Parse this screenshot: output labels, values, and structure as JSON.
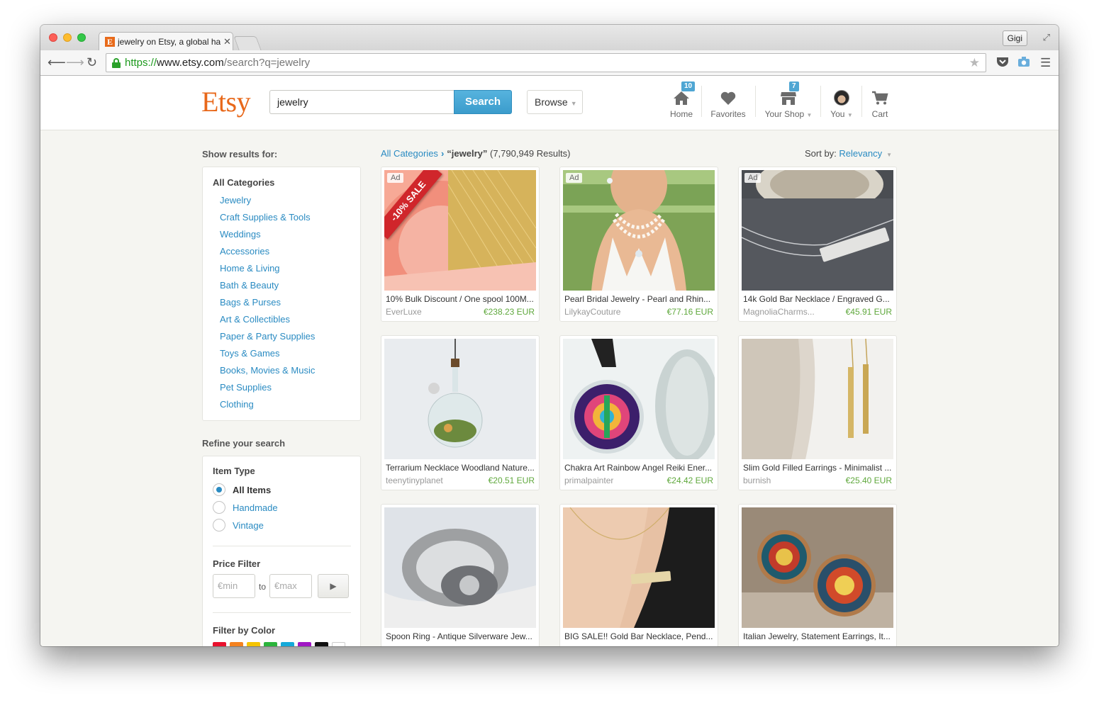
{
  "browser": {
    "tab_title": "jewelry on Etsy, a global handmade",
    "tab_favicon": "E",
    "profile_name": "Gigi",
    "url_scheme": "https://",
    "url_host": "www.etsy.com",
    "url_path": "/search?q=jewelry"
  },
  "header": {
    "logo": "Etsy",
    "search_value": "jewelry",
    "search_button": "Search",
    "browse_label": "Browse",
    "nav": [
      {
        "label": "Home",
        "badge": "10",
        "icon": "home-icon"
      },
      {
        "label": "Favorites",
        "badge": "",
        "icon": "heart-icon"
      },
      {
        "label": "Your Shop",
        "badge": "7",
        "icon": "shop-icon"
      },
      {
        "label": "You",
        "badge": "",
        "icon": "avatar"
      },
      {
        "label": "Cart",
        "badge": "",
        "icon": "cart-icon"
      }
    ]
  },
  "sidebar": {
    "show_results_heading": "Show results for:",
    "all_categories": "All Categories",
    "categories": [
      "Jewelry",
      "Craft Supplies & Tools",
      "Weddings",
      "Accessories",
      "Home & Living",
      "Bath & Beauty",
      "Bags & Purses",
      "Art & Collectibles",
      "Paper & Party Supplies",
      "Toys & Games",
      "Books, Movies & Music",
      "Pet Supplies",
      "Clothing"
    ],
    "refine_heading": "Refine your search",
    "item_type_heading": "Item Type",
    "item_types": [
      {
        "label": "All Items",
        "selected": true
      },
      {
        "label": "Handmade",
        "selected": false
      },
      {
        "label": "Vintage",
        "selected": false
      }
    ],
    "price_heading": "Price Filter",
    "price_min_placeholder": "€min",
    "price_to": "to",
    "price_max_placeholder": "€max",
    "color_heading": "Filter by Color",
    "colors": [
      "#e8112d",
      "#f4821f",
      "#f5c400",
      "#2bb43b",
      "#14a9d9",
      "#a017c4",
      "#111111",
      "#ffffff"
    ]
  },
  "results": {
    "breadcrumb_root": "All Categories",
    "query": "“jewelry”",
    "count": "(7,790,949 Results)",
    "sort_label": "Sort by:",
    "sort_value": "Relevancy",
    "ad_label": "Ad",
    "sale_text": "-10% SALE",
    "listings": [
      {
        "title": "10% Bulk Discount / One spool 100M...",
        "shop": "EverLuxe",
        "price": "€238.23 EUR",
        "ad": true
      },
      {
        "title": "Pearl Bridal Jewelry - Pearl and Rhin...",
        "shop": "LilykayCouture",
        "price": "€77.16 EUR",
        "ad": true
      },
      {
        "title": "14k Gold Bar Necklace / Engraved G...",
        "shop": "MagnoliaCharms...",
        "price": "€45.91 EUR",
        "ad": true
      },
      {
        "title": "Terrarium Necklace Woodland Nature...",
        "shop": "teenytinyplanet",
        "price": "€20.51 EUR",
        "ad": false
      },
      {
        "title": "Chakra Art Rainbow Angel Reiki Ener...",
        "shop": "primalpainter",
        "price": "€24.42 EUR",
        "ad": false
      },
      {
        "title": "Slim Gold Filled Earrings - Minimalist ...",
        "shop": "burnish",
        "price": "€25.40 EUR",
        "ad": false
      },
      {
        "title": "Spoon Ring - Antique Silverware Jew...",
        "shop": "",
        "price": "",
        "ad": false
      },
      {
        "title": "BIG SALE!! Gold Bar Necklace, Pend...",
        "shop": "",
        "price": "",
        "ad": false
      },
      {
        "title": "Italian Jewelry, Statement Earrings, It...",
        "shop": "",
        "price": "",
        "ad": false
      }
    ]
  }
}
